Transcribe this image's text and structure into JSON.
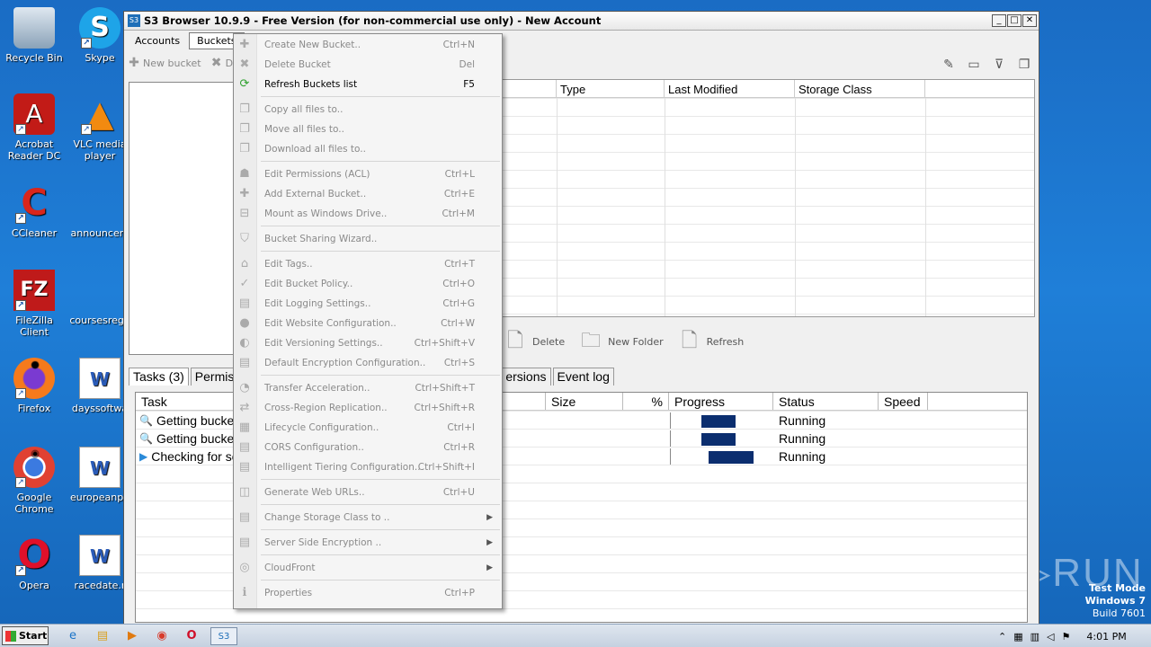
{
  "desktop": {
    "icons": [
      {
        "label": "Recycle Bin",
        "glyph": "🗑"
      },
      {
        "label": "Skype",
        "glyph": "S"
      },
      {
        "label": "Acrobat Reader DC",
        "glyph": "A"
      },
      {
        "label": "VLC media player",
        "glyph": "▲"
      },
      {
        "label": "CCleaner",
        "glyph": "C"
      },
      {
        "label": "announcem",
        "glyph": ""
      },
      {
        "label": "FileZilla Client",
        "glyph": "FZ"
      },
      {
        "label": "coursesrega",
        "glyph": ""
      },
      {
        "label": "Firefox",
        "glyph": "●"
      },
      {
        "label": "dayssoftwa",
        "glyph": "W"
      },
      {
        "label": "Google Chrome",
        "glyph": "◉"
      },
      {
        "label": "europeanpa",
        "glyph": "W"
      },
      {
        "label": "Opera",
        "glyph": "O"
      },
      {
        "label": "racedate.r",
        "glyph": "W"
      }
    ],
    "watermark": "ANY▷RUN",
    "test_mode": {
      "line1": "Test Mode",
      "line2": "Windows 7",
      "line3": "Build 7601"
    }
  },
  "window": {
    "icon_text": "S3",
    "title": "S3 Browser 10.9.9 - Free Version (for non-commercial use only) - New Account",
    "minimize": "_",
    "maximize": "□",
    "close": "✕"
  },
  "menubar": {
    "accounts": "Accounts",
    "buckets": "Buckets"
  },
  "toolbar": {
    "new_bucket": "New bucket",
    "delete": "De"
  },
  "files_grid": {
    "columns": [
      "Type",
      "Last Modified",
      "Storage Class"
    ]
  },
  "file_toolbar": {
    "delete": "Delete",
    "new_folder": "New Folder",
    "refresh": "Refresh"
  },
  "tabs": {
    "tasks": "Tasks (3)",
    "permissions": "Permis",
    "versions": "ersions",
    "event_log": "Event log"
  },
  "tasks_grid": {
    "columns": {
      "task": "Task",
      "size": "Size",
      "percent": "%",
      "progress": "Progress",
      "status": "Status",
      "speed": "Speed"
    },
    "rows": [
      {
        "icon": "search-icon",
        "name": "Getting buckets",
        "status": "Running",
        "progress": 0.3
      },
      {
        "icon": "search-icon",
        "name": "Getting buckets",
        "status": "Running",
        "progress": 0.3
      },
      {
        "icon": "play-icon",
        "name": "Checking for so",
        "status": "Running",
        "progress": 0.4
      }
    ]
  },
  "buckets_menu": {
    "items": [
      {
        "label": "Create New Bucket..",
        "shortcut": "Ctrl+N",
        "enabled": false
      },
      {
        "label": "Delete Bucket",
        "shortcut": "Del",
        "enabled": false
      },
      {
        "label": "Refresh Buckets list",
        "shortcut": "F5",
        "enabled": true
      },
      {
        "label": "Copy all files to..",
        "shortcut": "",
        "enabled": false
      },
      {
        "label": "Move all files to..",
        "shortcut": "",
        "enabled": false
      },
      {
        "label": "Download all files to..",
        "shortcut": "",
        "enabled": false
      },
      {
        "label": "Edit Permissions (ACL)",
        "shortcut": "Ctrl+L",
        "enabled": false
      },
      {
        "label": "Add External Bucket..",
        "shortcut": "Ctrl+E",
        "enabled": false
      },
      {
        "label": "Mount as Windows Drive..",
        "shortcut": "Ctrl+M",
        "enabled": false
      },
      {
        "label": "Bucket Sharing Wizard..",
        "shortcut": "",
        "enabled": false
      },
      {
        "label": "Edit Tags..",
        "shortcut": "Ctrl+T",
        "enabled": false
      },
      {
        "label": "Edit Bucket Policy..",
        "shortcut": "Ctrl+O",
        "enabled": false
      },
      {
        "label": "Edit Logging Settings..",
        "shortcut": "Ctrl+G",
        "enabled": false
      },
      {
        "label": "Edit Website Configuration..",
        "shortcut": "Ctrl+W",
        "enabled": false
      },
      {
        "label": "Edit Versioning Settings..",
        "shortcut": "Ctrl+Shift+V",
        "enabled": false
      },
      {
        "label": "Default Encryption Configuration..",
        "shortcut": "Ctrl+S",
        "enabled": false
      },
      {
        "label": "Transfer Acceleration..",
        "shortcut": "Ctrl+Shift+T",
        "enabled": false
      },
      {
        "label": "Cross-Region Replication..",
        "shortcut": "Ctrl+Shift+R",
        "enabled": false
      },
      {
        "label": "Lifecycle Configuration..",
        "shortcut": "Ctrl+I",
        "enabled": false
      },
      {
        "label": "CORS Configuration..",
        "shortcut": "Ctrl+R",
        "enabled": false
      },
      {
        "label": "Intelligent Tiering Configuration..",
        "shortcut": "Ctrl+Shift+I",
        "enabled": false
      },
      {
        "label": "Generate Web URLs..",
        "shortcut": "Ctrl+U",
        "enabled": false
      },
      {
        "label": "Change Storage Class to ..",
        "shortcut": "",
        "submenu": "▶",
        "enabled": false
      },
      {
        "label": "Server Side Encryption ..",
        "shortcut": "",
        "submenu": "▶",
        "enabled": false
      },
      {
        "label": "CloudFront",
        "shortcut": "",
        "submenu": "▶",
        "enabled": false
      },
      {
        "label": "Properties",
        "shortcut": "Ctrl+P",
        "enabled": false
      }
    ]
  },
  "taskbar": {
    "start": "Start",
    "clock": "4:01 PM"
  }
}
